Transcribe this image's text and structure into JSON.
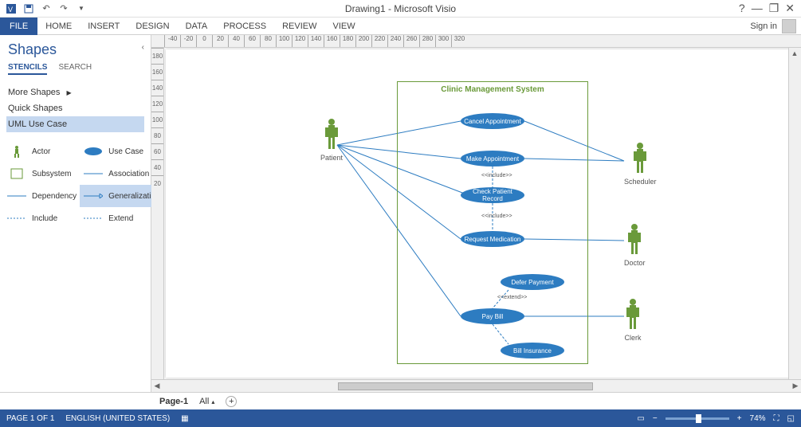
{
  "app_title": "Drawing1 - Microsoft Visio",
  "ribbon": {
    "file": "FILE",
    "tabs": [
      "HOME",
      "INSERT",
      "DESIGN",
      "DATA",
      "PROCESS",
      "REVIEW",
      "VIEW"
    ],
    "signin": "Sign in"
  },
  "shapes_pane": {
    "title": "Shapes",
    "subtabs": {
      "stencils": "STENCILS",
      "search": "SEARCH"
    },
    "stencils": {
      "more": "More Shapes",
      "quick": "Quick Shapes",
      "uml": "UML Use Case"
    },
    "shapes": {
      "actor": "Actor",
      "usecase": "Use Case",
      "subsystem": "Subsystem",
      "association": "Association",
      "dependency": "Dependency",
      "generalization": "Generalizati...",
      "include": "Include",
      "extend": "Extend"
    }
  },
  "diagram": {
    "subsystem_title": "Clinic Management System",
    "actors": {
      "patient": "Patient",
      "scheduler": "Scheduler",
      "doctor": "Doctor",
      "clerk": "Clerk"
    },
    "usecases": {
      "cancel": "Cancel Appointment",
      "make": "Make Appointment",
      "check": "Check Patient Record",
      "request": "Request Medication",
      "defer": "Defer Payment",
      "pay": "Pay Bill",
      "bill": "Bill Insurance"
    },
    "stereotypes": {
      "include": "<<include>>",
      "extend": "<<extend>>"
    }
  },
  "page_tabs": {
    "page1": "Page-1",
    "all": "All"
  },
  "status": {
    "page": "PAGE 1 OF 1",
    "lang": "ENGLISH (UNITED STATES)",
    "zoom": "74%"
  },
  "ruler_h": [
    "-40",
    "-20",
    "0",
    "20",
    "40",
    "60",
    "80",
    "100",
    "120",
    "140",
    "160",
    "180",
    "200",
    "220",
    "240",
    "260",
    "280",
    "300",
    "320"
  ],
  "ruler_v": [
    "180",
    "160",
    "140",
    "120",
    "100",
    "80",
    "60",
    "40",
    "20"
  ]
}
